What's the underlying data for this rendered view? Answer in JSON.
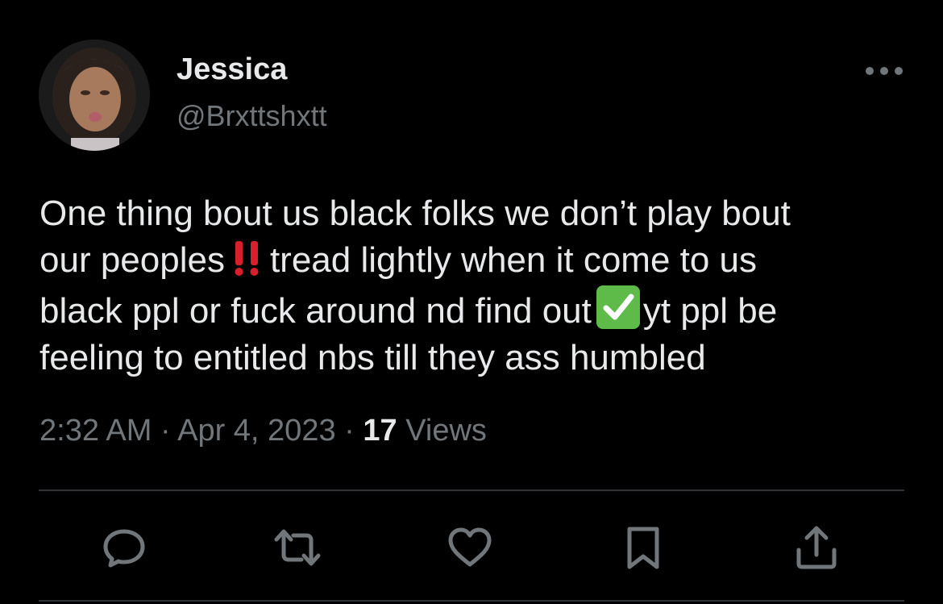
{
  "author": {
    "display_name": "Jessica",
    "handle": "@Brxttshxtt",
    "avatar_icon": "profile-photo"
  },
  "tweet": {
    "lines": [
      [
        "One thing bout us black folks we don’t play bout"
      ],
      [
        "our peoples",
        "tread lightly when it come to us"
      ],
      [
        "black ppl or fuck around nd find out",
        "yt ppl be"
      ],
      [
        "feeling to entitled nbs till they ass humbled"
      ]
    ],
    "emojis": [
      "double-exclamation-mark",
      "check-mark-button"
    ]
  },
  "meta": {
    "time": "2:32 AM",
    "separator": " · ",
    "date": "Apr 4, 2023",
    "views_count": "17",
    "views_label": " Views"
  },
  "actions": [
    {
      "name": "reply",
      "icon": "reply-icon"
    },
    {
      "name": "retweet",
      "icon": "retweet-icon"
    },
    {
      "name": "like",
      "icon": "heart-icon"
    },
    {
      "name": "bookmark",
      "icon": "bookmark-icon"
    },
    {
      "name": "share",
      "icon": "share-icon"
    }
  ],
  "colors": {
    "background": "#000000",
    "primary_text": "#e7e9ea",
    "secondary_text": "#71767b",
    "divider": "#2f3336",
    "bang_emoji": "#d91f2b",
    "check_emoji": "#5ebb49"
  }
}
